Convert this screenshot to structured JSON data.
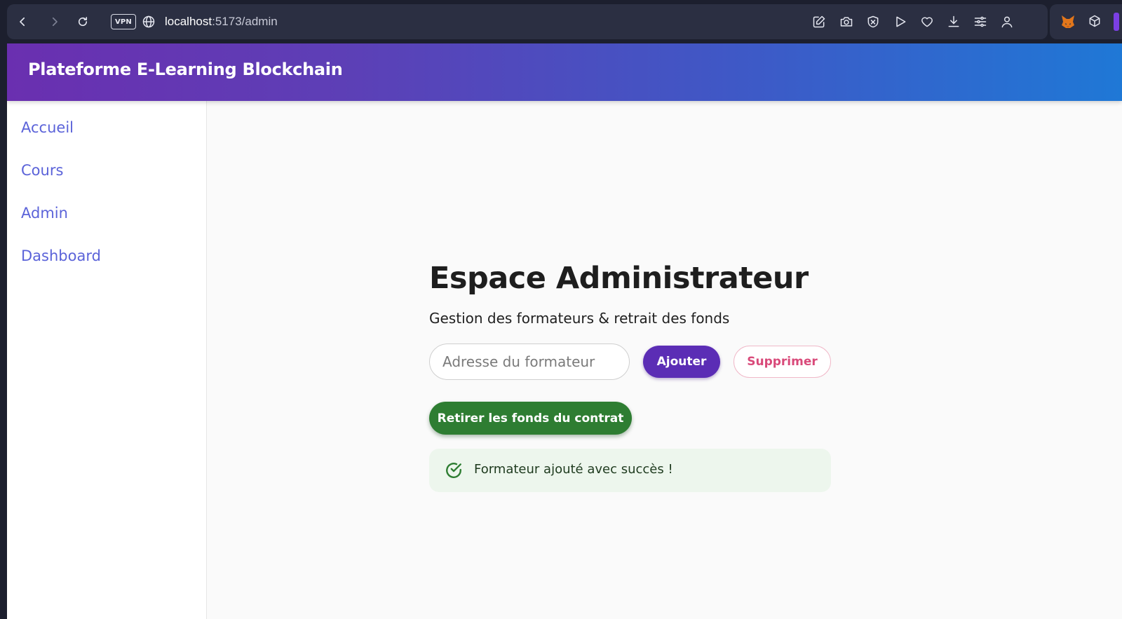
{
  "browser": {
    "vpn_label": "VPN",
    "url_host": "localhost",
    "url_rest": ":5173/admin"
  },
  "icons": {
    "back": "arrow-left-icon",
    "forward": "arrow-right-icon",
    "reload": "reload-icon",
    "globe": "globe-icon",
    "toolbar": [
      "edit-icon",
      "camera-icon",
      "shield-icon",
      "play-icon",
      "heart-icon",
      "download-icon",
      "sliders-icon",
      "account-icon"
    ],
    "extensions": [
      "metamask-fox-icon",
      "cube-icon"
    ],
    "alert": "check-circle-icon"
  },
  "header": {
    "title": "Plateforme E-Learning Blockchain"
  },
  "sidebar": {
    "items": [
      {
        "label": "Accueil"
      },
      {
        "label": "Cours"
      },
      {
        "label": "Admin"
      },
      {
        "label": "Dashboard"
      }
    ]
  },
  "main": {
    "title": "Espace Administrateur",
    "subtitle": "Gestion des formateurs & retrait des fonds",
    "address_input": {
      "value": "",
      "placeholder": "Adresse du formateur"
    },
    "add_label": "Ajouter",
    "remove_label": "Supprimer",
    "withdraw_label": "Retirer les fonds du contrat",
    "alert_message": "Formateur ajouté avec succès !"
  },
  "colors": {
    "header_gradient_start": "#6a2fb0",
    "header_gradient_end": "#1f78d6",
    "link": "#5b63d9",
    "add_button": "#5b2db5",
    "remove_text": "#d94a7a",
    "withdraw_button": "#2e7d32",
    "alert_bg": "#edf6ed",
    "alert_icon": "#2e7d32"
  }
}
